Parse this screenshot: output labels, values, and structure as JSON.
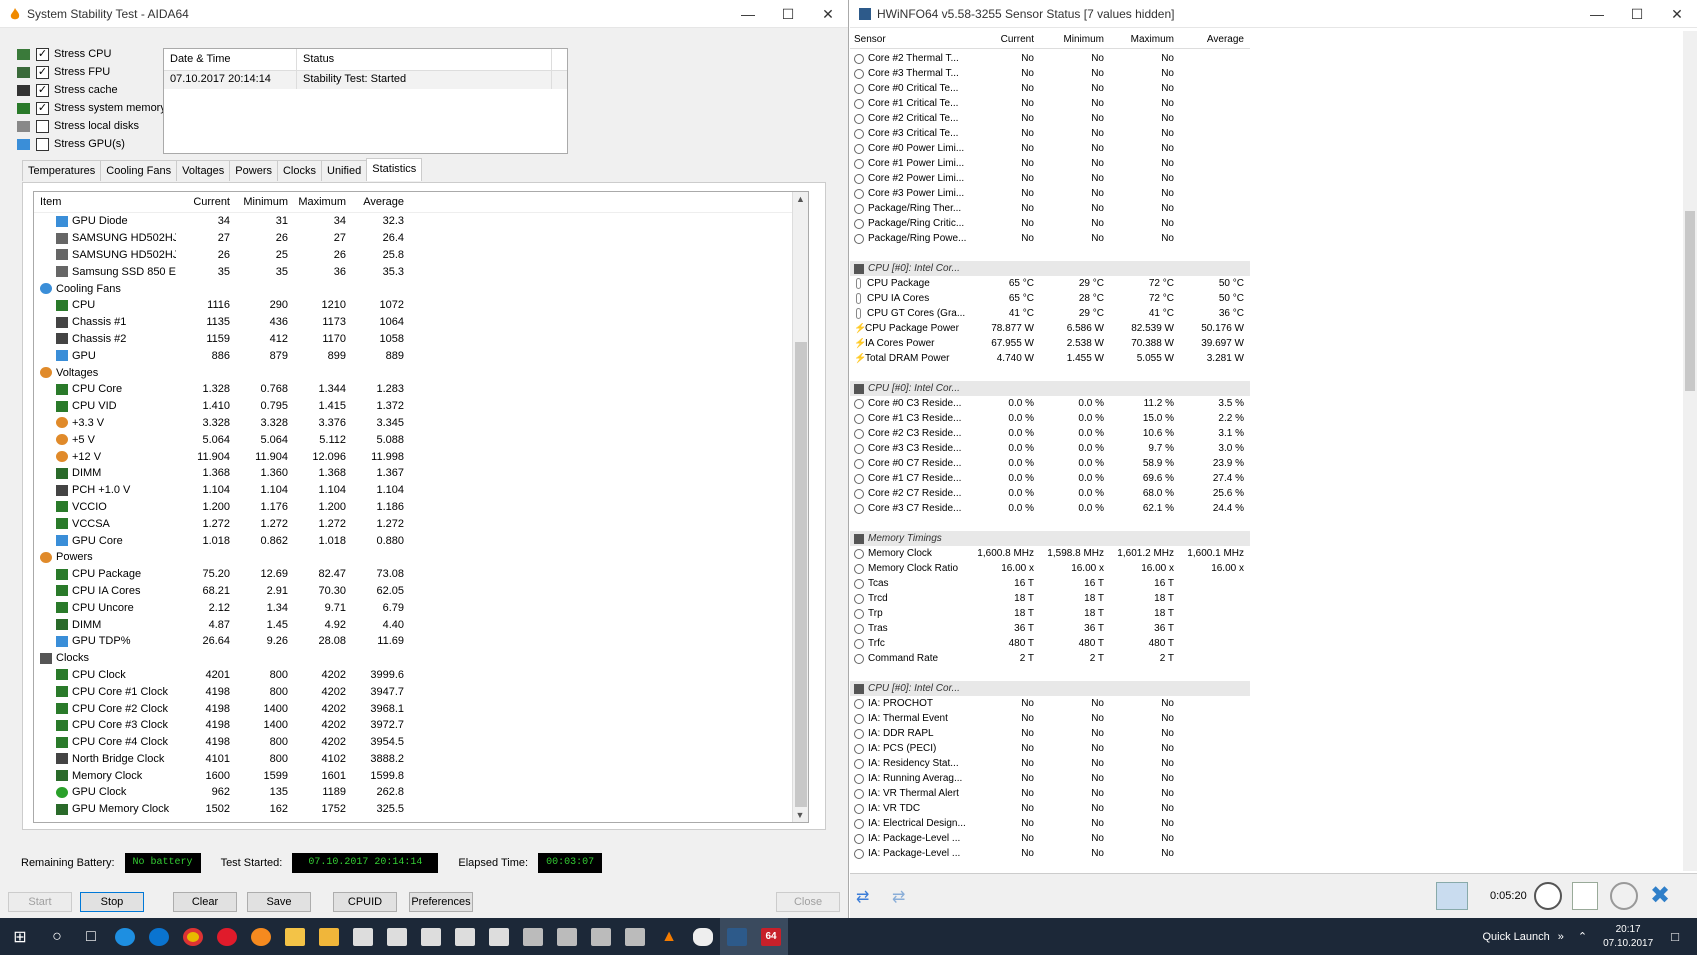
{
  "aida": {
    "title": "System Stability Test - AIDA64",
    "stress_options": [
      {
        "label": "Stress CPU",
        "checked": true
      },
      {
        "label": "Stress FPU",
        "checked": true
      },
      {
        "label": "Stress cache",
        "checked": true
      },
      {
        "label": "Stress system memory",
        "checked": true
      },
      {
        "label": "Stress local disks",
        "checked": false
      },
      {
        "label": "Stress GPU(s)",
        "checked": false
      }
    ],
    "status_headers": [
      "Date & Time",
      "Status"
    ],
    "status_row": [
      "07.10.2017 20:14:14",
      "Stability Test: Started"
    ],
    "tabs": [
      "Temperatures",
      "Cooling Fans",
      "Voltages",
      "Powers",
      "Clocks",
      "Unified",
      "Statistics"
    ],
    "active_tab": "Statistics",
    "stats_headers": [
      "Item",
      "Current",
      "Minimum",
      "Maximum",
      "Average"
    ],
    "stats_rows": [
      {
        "t": "i",
        "icon": "gpu",
        "name": "GPU Diode",
        "v": [
          "34",
          "31",
          "34",
          "32.3"
        ]
      },
      {
        "t": "i",
        "icon": "disk",
        "name": "SAMSUNG HD502HJ ...",
        "v": [
          "27",
          "26",
          "27",
          "26.4"
        ]
      },
      {
        "t": "i",
        "icon": "disk",
        "name": "SAMSUNG HD502HJ ...",
        "v": [
          "26",
          "25",
          "26",
          "25.8"
        ]
      },
      {
        "t": "i",
        "icon": "disk",
        "name": "Samsung SSD 850 EV...",
        "v": [
          "35",
          "35",
          "36",
          "35.3"
        ]
      },
      {
        "t": "g",
        "icon": "fan",
        "name": "Cooling Fans"
      },
      {
        "t": "i",
        "icon": "cpu",
        "name": "CPU",
        "v": [
          "1116",
          "290",
          "1210",
          "1072"
        ]
      },
      {
        "t": "i",
        "icon": "chassis",
        "name": "Chassis #1",
        "v": [
          "1135",
          "436",
          "1173",
          "1064"
        ]
      },
      {
        "t": "i",
        "icon": "chassis",
        "name": "Chassis #2",
        "v": [
          "1159",
          "412",
          "1170",
          "1058"
        ]
      },
      {
        "t": "i",
        "icon": "gpu",
        "name": "GPU",
        "v": [
          "886",
          "879",
          "899",
          "889"
        ]
      },
      {
        "t": "g",
        "icon": "volt",
        "name": "Voltages"
      },
      {
        "t": "i",
        "icon": "cpu",
        "name": "CPU Core",
        "v": [
          "1.328",
          "0.768",
          "1.344",
          "1.283"
        ]
      },
      {
        "t": "i",
        "icon": "cpu",
        "name": "CPU VID",
        "v": [
          "1.410",
          "0.795",
          "1.415",
          "1.372"
        ]
      },
      {
        "t": "i",
        "icon": "volt",
        "name": "+3.3 V",
        "v": [
          "3.328",
          "3.328",
          "3.376",
          "3.345"
        ]
      },
      {
        "t": "i",
        "icon": "volt",
        "name": "+5 V",
        "v": [
          "5.064",
          "5.064",
          "5.112",
          "5.088"
        ]
      },
      {
        "t": "i",
        "icon": "volt",
        "name": "+12 V",
        "v": [
          "11.904",
          "11.904",
          "12.096",
          "11.998"
        ]
      },
      {
        "t": "i",
        "icon": "mem",
        "name": "DIMM",
        "v": [
          "1.368",
          "1.360",
          "1.368",
          "1.367"
        ]
      },
      {
        "t": "i",
        "icon": "chassis",
        "name": "PCH +1.0 V",
        "v": [
          "1.104",
          "1.104",
          "1.104",
          "1.104"
        ]
      },
      {
        "t": "i",
        "icon": "cpu",
        "name": "VCCIO",
        "v": [
          "1.200",
          "1.176",
          "1.200",
          "1.186"
        ]
      },
      {
        "t": "i",
        "icon": "cpu",
        "name": "VCCSA",
        "v": [
          "1.272",
          "1.272",
          "1.272",
          "1.272"
        ]
      },
      {
        "t": "i",
        "icon": "gpu",
        "name": "GPU Core",
        "v": [
          "1.018",
          "0.862",
          "1.018",
          "0.880"
        ]
      },
      {
        "t": "g",
        "icon": "volt",
        "name": "Powers"
      },
      {
        "t": "i",
        "icon": "cpu",
        "name": "CPU Package",
        "v": [
          "75.20",
          "12.69",
          "82.47",
          "73.08"
        ]
      },
      {
        "t": "i",
        "icon": "cpu",
        "name": "CPU IA Cores",
        "v": [
          "68.21",
          "2.91",
          "70.30",
          "62.05"
        ]
      },
      {
        "t": "i",
        "icon": "cpu",
        "name": "CPU Uncore",
        "v": [
          "2.12",
          "1.34",
          "9.71",
          "6.79"
        ]
      },
      {
        "t": "i",
        "icon": "mem",
        "name": "DIMM",
        "v": [
          "4.87",
          "1.45",
          "4.92",
          "4.40"
        ]
      },
      {
        "t": "i",
        "icon": "gpu",
        "name": "GPU TDP%",
        "v": [
          "26.64",
          "9.26",
          "28.08",
          "11.69"
        ]
      },
      {
        "t": "g",
        "icon": "clock",
        "name": "Clocks"
      },
      {
        "t": "i",
        "icon": "cpu",
        "name": "CPU Clock",
        "v": [
          "4201",
          "800",
          "4202",
          "3999.6"
        ]
      },
      {
        "t": "i",
        "icon": "cpu",
        "name": "CPU Core #1 Clock",
        "v": [
          "4198",
          "800",
          "4202",
          "3947.7"
        ]
      },
      {
        "t": "i",
        "icon": "cpu",
        "name": "CPU Core #2 Clock",
        "v": [
          "4198",
          "1400",
          "4202",
          "3968.1"
        ]
      },
      {
        "t": "i",
        "icon": "cpu",
        "name": "CPU Core #3 Clock",
        "v": [
          "4198",
          "1400",
          "4202",
          "3972.7"
        ]
      },
      {
        "t": "i",
        "icon": "cpu",
        "name": "CPU Core #4 Clock",
        "v": [
          "4198",
          "800",
          "4202",
          "3954.5"
        ]
      },
      {
        "t": "i",
        "icon": "chassis",
        "name": "North Bridge Clock",
        "v": [
          "4101",
          "800",
          "4102",
          "3888.2"
        ]
      },
      {
        "t": "i",
        "icon": "mem",
        "name": "Memory Clock",
        "v": [
          "1600",
          "1599",
          "1601",
          "1599.8"
        ]
      },
      {
        "t": "i",
        "icon": "xbox",
        "name": "GPU Clock",
        "v": [
          "962",
          "135",
          "1189",
          "262.8"
        ]
      },
      {
        "t": "i",
        "icon": "mem",
        "name": "GPU Memory Clock",
        "v": [
          "1502",
          "162",
          "1752",
          "325.5"
        ]
      }
    ],
    "remaining_battery_label": "Remaining Battery:",
    "remaining_battery": "No battery",
    "test_started_label": "Test Started:",
    "test_started": "07.10.2017 20:14:14",
    "elapsed_label": "Elapsed Time:",
    "elapsed": "00:03:07",
    "buttons": {
      "start": "Start",
      "stop": "Stop",
      "clear": "Clear",
      "save": "Save",
      "cpuid": "CPUID",
      "preferences": "Preferences",
      "close": "Close"
    }
  },
  "hwinfo": {
    "title": "HWiNFO64 v5.58-3255 Sensor Status [7 values hidden]",
    "headers": [
      "Sensor",
      "Current",
      "Minimum",
      "Maximum",
      "Average"
    ],
    "rows": [
      {
        "t": "r",
        "i": "c",
        "s": "Core #2 Thermal T...",
        "v": [
          "No",
          "No",
          "No",
          ""
        ]
      },
      {
        "t": "r",
        "i": "c",
        "s": "Core #3 Thermal T...",
        "v": [
          "No",
          "No",
          "No",
          ""
        ]
      },
      {
        "t": "r",
        "i": "c",
        "s": "Core #0 Critical Te...",
        "v": [
          "No",
          "No",
          "No",
          ""
        ]
      },
      {
        "t": "r",
        "i": "c",
        "s": "Core #1 Critical Te...",
        "v": [
          "No",
          "No",
          "No",
          ""
        ]
      },
      {
        "t": "r",
        "i": "c",
        "s": "Core #2 Critical Te...",
        "v": [
          "No",
          "No",
          "No",
          ""
        ]
      },
      {
        "t": "r",
        "i": "c",
        "s": "Core #3 Critical Te...",
        "v": [
          "No",
          "No",
          "No",
          ""
        ]
      },
      {
        "t": "r",
        "i": "c",
        "s": "Core #0 Power Limi...",
        "v": [
          "No",
          "No",
          "No",
          ""
        ]
      },
      {
        "t": "r",
        "i": "c",
        "s": "Core #1 Power Limi...",
        "v": [
          "No",
          "No",
          "No",
          ""
        ]
      },
      {
        "t": "r",
        "i": "c",
        "s": "Core #2 Power Limi...",
        "v": [
          "No",
          "No",
          "No",
          ""
        ]
      },
      {
        "t": "r",
        "i": "c",
        "s": "Core #3 Power Limi...",
        "v": [
          "No",
          "No",
          "No",
          ""
        ]
      },
      {
        "t": "r",
        "i": "c",
        "s": "Package/Ring Ther...",
        "v": [
          "No",
          "No",
          "No",
          ""
        ]
      },
      {
        "t": "r",
        "i": "c",
        "s": "Package/Ring Critic...",
        "v": [
          "No",
          "No",
          "No",
          ""
        ]
      },
      {
        "t": "r",
        "i": "c",
        "s": "Package/Ring Powe...",
        "v": [
          "No",
          "No",
          "No",
          ""
        ]
      },
      {
        "t": "gap"
      },
      {
        "t": "g",
        "s": "CPU [#0]: Intel Cor..."
      },
      {
        "t": "r",
        "i": "t",
        "s": "CPU Package",
        "v": [
          "65 °C",
          "29 °C",
          "72 °C",
          "50 °C"
        ]
      },
      {
        "t": "r",
        "i": "t",
        "s": "CPU IA Cores",
        "v": [
          "65 °C",
          "28 °C",
          "72 °C",
          "50 °C"
        ]
      },
      {
        "t": "r",
        "i": "t",
        "s": "CPU GT Cores (Gra...",
        "v": [
          "41 °C",
          "29 °C",
          "41 °C",
          "36 °C"
        ]
      },
      {
        "t": "r",
        "i": "p",
        "s": "CPU Package Power",
        "v": [
          "78.877 W",
          "6.586 W",
          "82.539 W",
          "50.176 W"
        ]
      },
      {
        "t": "r",
        "i": "p",
        "s": "IA Cores Power",
        "v": [
          "67.955 W",
          "2.538 W",
          "70.388 W",
          "39.697 W"
        ]
      },
      {
        "t": "r",
        "i": "p",
        "s": "Total DRAM Power",
        "v": [
          "4.740 W",
          "1.455 W",
          "5.055 W",
          "3.281 W"
        ]
      },
      {
        "t": "gap"
      },
      {
        "t": "g",
        "s": "CPU [#0]: Intel Cor..."
      },
      {
        "t": "r",
        "i": "c",
        "s": "Core #0 C3 Reside...",
        "v": [
          "0.0 %",
          "0.0 %",
          "11.2 %",
          "3.5 %"
        ]
      },
      {
        "t": "r",
        "i": "c",
        "s": "Core #1 C3 Reside...",
        "v": [
          "0.0 %",
          "0.0 %",
          "15.0 %",
          "2.2 %"
        ]
      },
      {
        "t": "r",
        "i": "c",
        "s": "Core #2 C3 Reside...",
        "v": [
          "0.0 %",
          "0.0 %",
          "10.6 %",
          "3.1 %"
        ]
      },
      {
        "t": "r",
        "i": "c",
        "s": "Core #3 C3 Reside...",
        "v": [
          "0.0 %",
          "0.0 %",
          "9.7 %",
          "3.0 %"
        ]
      },
      {
        "t": "r",
        "i": "c",
        "s": "Core #0 C7 Reside...",
        "v": [
          "0.0 %",
          "0.0 %",
          "58.9 %",
          "23.9 %"
        ]
      },
      {
        "t": "r",
        "i": "c",
        "s": "Core #1 C7 Reside...",
        "v": [
          "0.0 %",
          "0.0 %",
          "69.6 %",
          "27.4 %"
        ]
      },
      {
        "t": "r",
        "i": "c",
        "s": "Core #2 C7 Reside...",
        "v": [
          "0.0 %",
          "0.0 %",
          "68.0 %",
          "25.6 %"
        ]
      },
      {
        "t": "r",
        "i": "c",
        "s": "Core #3 C7 Reside...",
        "v": [
          "0.0 %",
          "0.0 %",
          "62.1 %",
          "24.4 %"
        ]
      },
      {
        "t": "gap"
      },
      {
        "t": "g",
        "s": "Memory Timings"
      },
      {
        "t": "r",
        "i": "c",
        "s": "Memory Clock",
        "v": [
          "1,600.8 MHz",
          "1,598.8 MHz",
          "1,601.2 MHz",
          "1,600.1 MHz"
        ]
      },
      {
        "t": "r",
        "i": "c",
        "s": "Memory Clock Ratio",
        "v": [
          "16.00 x",
          "16.00 x",
          "16.00 x",
          "16.00 x"
        ]
      },
      {
        "t": "r",
        "i": "c",
        "s": "Tcas",
        "v": [
          "16 T",
          "16 T",
          "16 T",
          ""
        ]
      },
      {
        "t": "r",
        "i": "c",
        "s": "Trcd",
        "v": [
          "18 T",
          "18 T",
          "18 T",
          ""
        ]
      },
      {
        "t": "r",
        "i": "c",
        "s": "Trp",
        "v": [
          "18 T",
          "18 T",
          "18 T",
          ""
        ]
      },
      {
        "t": "r",
        "i": "c",
        "s": "Tras",
        "v": [
          "36 T",
          "36 T",
          "36 T",
          ""
        ]
      },
      {
        "t": "r",
        "i": "c",
        "s": "Trfc",
        "v": [
          "480 T",
          "480 T",
          "480 T",
          ""
        ]
      },
      {
        "t": "r",
        "i": "c",
        "s": "Command Rate",
        "v": [
          "2 T",
          "2 T",
          "2 T",
          ""
        ]
      },
      {
        "t": "gap"
      },
      {
        "t": "g",
        "s": "CPU [#0]: Intel Cor..."
      },
      {
        "t": "r",
        "i": "c",
        "s": "IA: PROCHOT",
        "v": [
          "No",
          "No",
          "No",
          ""
        ]
      },
      {
        "t": "r",
        "i": "c",
        "s": "IA: Thermal Event",
        "v": [
          "No",
          "No",
          "No",
          ""
        ]
      },
      {
        "t": "r",
        "i": "c",
        "s": "IA: DDR RAPL",
        "v": [
          "No",
          "No",
          "No",
          ""
        ]
      },
      {
        "t": "r",
        "i": "c",
        "s": "IA: PCS (PECI)",
        "v": [
          "No",
          "No",
          "No",
          ""
        ]
      },
      {
        "t": "r",
        "i": "c",
        "s": "IA: Residency Stat...",
        "v": [
          "No",
          "No",
          "No",
          ""
        ]
      },
      {
        "t": "r",
        "i": "c",
        "s": "IA: Running Averag...",
        "v": [
          "No",
          "No",
          "No",
          ""
        ]
      },
      {
        "t": "r",
        "i": "c",
        "s": "IA: VR Thermal Alert",
        "v": [
          "No",
          "No",
          "No",
          ""
        ]
      },
      {
        "t": "r",
        "i": "c",
        "s": "IA: VR TDC",
        "v": [
          "No",
          "No",
          "No",
          ""
        ]
      },
      {
        "t": "r",
        "i": "c",
        "s": "IA: Electrical Design...",
        "v": [
          "No",
          "No",
          "No",
          ""
        ]
      },
      {
        "t": "r",
        "i": "c",
        "s": "IA: Package-Level ...",
        "v": [
          "No",
          "No",
          "No",
          ""
        ]
      },
      {
        "t": "r",
        "i": "c",
        "s": "IA: Package-Level ...",
        "v": [
          "No",
          "No",
          "No",
          ""
        ]
      }
    ],
    "timer": "0:05:20"
  },
  "taskbar": {
    "quick_launch": "Quick Launch",
    "time": "20:17",
    "date": "07.10.2017",
    "aida_badge": "64"
  }
}
